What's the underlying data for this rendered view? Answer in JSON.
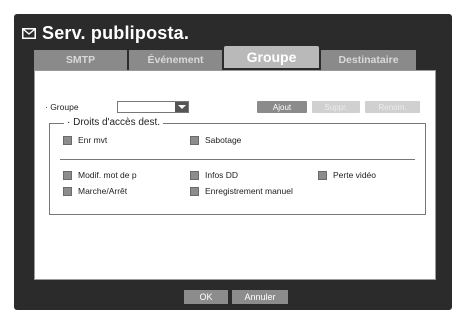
{
  "window": {
    "title": "Serv. publiposta.",
    "title_icon": "mail-icon"
  },
  "tabs": [
    {
      "label": "SMTP",
      "active": false
    },
    {
      "label": "Événement",
      "active": false
    },
    {
      "label": "Groupe",
      "active": true
    },
    {
      "label": "Destinataire",
      "active": false
    }
  ],
  "group": {
    "label": "· Groupe",
    "select_value": "",
    "buttons": {
      "add": "Ajout",
      "delete": "Suppr.",
      "rename": "Renom."
    }
  },
  "permissions": {
    "legend": "· Droits d'accès dest.",
    "items": [
      {
        "label": "Enr mvt",
        "checked": false
      },
      {
        "label": "Sabotage",
        "checked": false
      },
      {
        "label": "Modif. mot de p",
        "checked": false
      },
      {
        "label": "Infos DD",
        "checked": false
      },
      {
        "label": "Perte vidéo",
        "checked": false
      },
      {
        "label": "Marche/Arrêt",
        "checked": false
      },
      {
        "label": "Enregistrement manuel",
        "checked": false
      }
    ]
  },
  "footer": {
    "ok_label": "OK",
    "cancel_label": "Annuler"
  },
  "colors": {
    "frame": "#2b2b2b",
    "tab_inactive": "#8a8a8a",
    "tab_active": "#b9b9b9",
    "button": "#8b8b8b",
    "button_disabled": "#d0d0d0"
  }
}
